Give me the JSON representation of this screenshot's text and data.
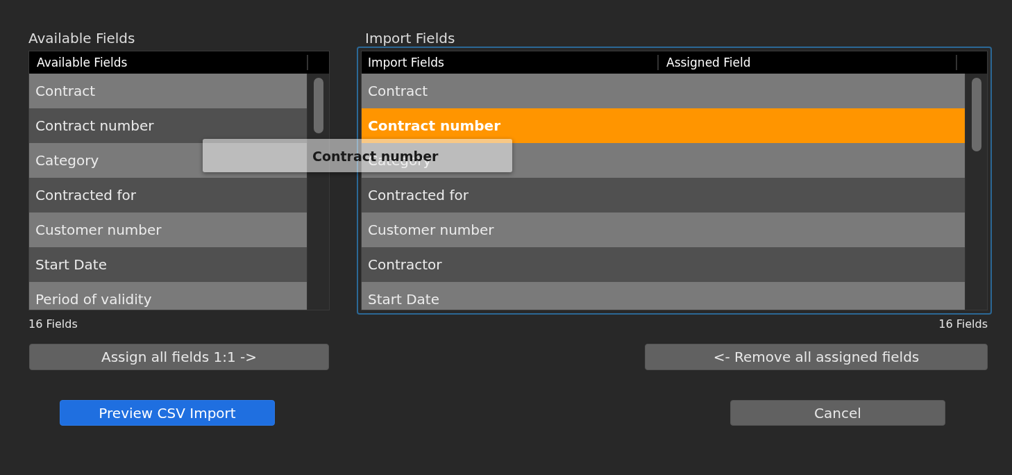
{
  "left": {
    "title": "Available Fields",
    "columns": [
      "Available Fields"
    ],
    "rows": [
      {
        "text": "Contract",
        "selected": false
      },
      {
        "text": "Contract number",
        "selected": false
      },
      {
        "text": "Category",
        "selected": false
      },
      {
        "text": "Contracted for",
        "selected": false
      },
      {
        "text": "Customer number",
        "selected": false
      },
      {
        "text": "Start Date",
        "selected": false
      },
      {
        "text": "Period of validity",
        "selected": false
      }
    ],
    "count": "16 Fields",
    "button": "Assign all fields 1:1 ->"
  },
  "right": {
    "title": "Import Fields",
    "focused": true,
    "columns": [
      "Import Fields",
      "Assigned Field"
    ],
    "rows": [
      {
        "text": "Contract",
        "selected": false
      },
      {
        "text": "Contract number",
        "selected": true
      },
      {
        "text": "Category",
        "selected": false
      },
      {
        "text": "Contracted for",
        "selected": false
      },
      {
        "text": "Customer number",
        "selected": false
      },
      {
        "text": "Contractor",
        "selected": false
      },
      {
        "text": "Start Date",
        "selected": false
      }
    ],
    "count": "16 Fields",
    "button": "<- Remove all assigned fields"
  },
  "drag_item": {
    "label": "Contract number"
  },
  "footer_buttons": [
    {
      "label": "Preview CSV Import",
      "kind": "default"
    },
    {
      "label": "Cancel",
      "kind": "normal"
    }
  ]
}
